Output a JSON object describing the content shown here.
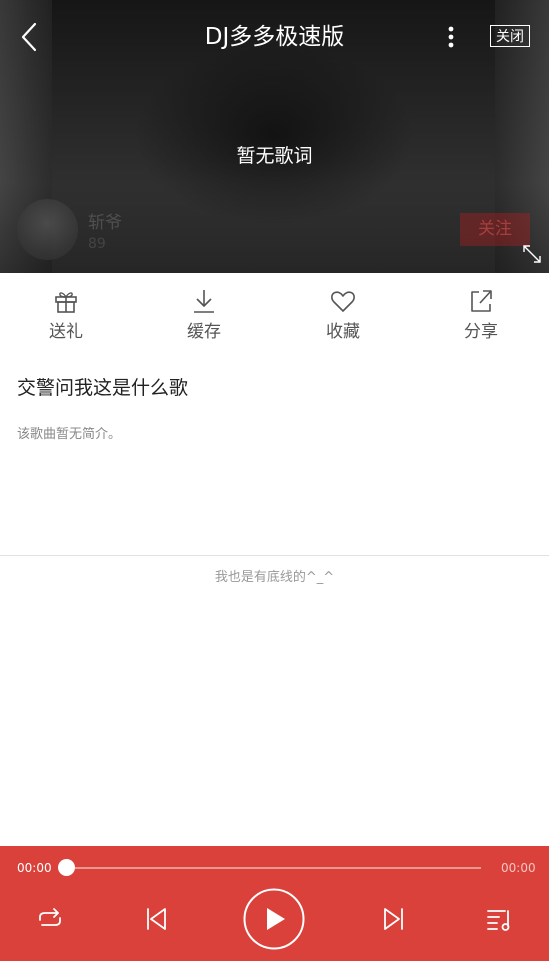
{
  "header": {
    "title": "DJ多多极速版",
    "close_label": "关闭"
  },
  "lyrics": {
    "text": "暂无歌词"
  },
  "artist": {
    "name": "斩爷",
    "count": "89",
    "follow_label": "关注"
  },
  "actions": [
    {
      "label": "送礼",
      "icon": "gift-icon"
    },
    {
      "label": "缓存",
      "icon": "download-icon"
    },
    {
      "label": "收藏",
      "icon": "heart-icon"
    },
    {
      "label": "分享",
      "icon": "share-icon"
    }
  ],
  "song": {
    "title": "交警问我这是什么歌",
    "description": "该歌曲暂无简介。"
  },
  "footer_note": "我也是有底线的^_^",
  "player": {
    "current_time": "00:00",
    "total_time": "00:00",
    "progress": 0,
    "accent_color": "#d9413a"
  }
}
